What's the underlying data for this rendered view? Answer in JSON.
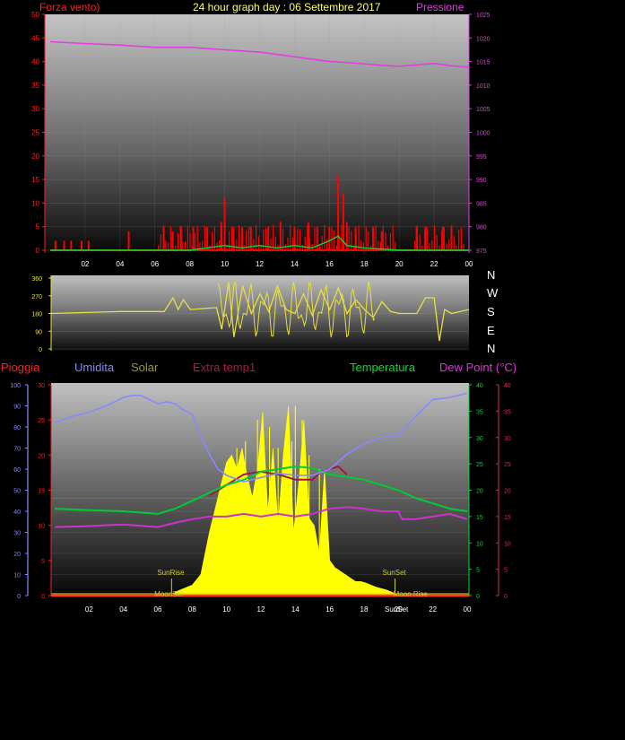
{
  "header": {
    "left_label": "Forza vento)",
    "title": "24 hour graph day : 06 Settembre 2017",
    "right_label": "Pressione"
  },
  "legend": {
    "pioggia": "Pioggia",
    "umidita": "Umidita",
    "solar": "Solar",
    "extra": "Extra temp1",
    "temp": "Temperatura",
    "dew": "Dew Point (°C)"
  },
  "directions": [
    "N",
    "W",
    "S",
    "E",
    "N"
  ],
  "annotations": {
    "sunrise": "SunRise",
    "sunset": "SunSet",
    "moonset": "MoonSet",
    "moonrise": "Moon Rise",
    "sunset2": "SunSet"
  },
  "colors": {
    "wind": "#ff0000",
    "gust": "#cc0000",
    "pressure": "#e040e0",
    "direction": "#e8e040",
    "humidity": "#8888ff",
    "solar": "#ffff00",
    "extra": "#a01840",
    "temp": "#00cc33",
    "dew": "#cc33cc",
    "rain": "#ff3333"
  },
  "chart_data": [
    {
      "type": "line",
      "name": "wind_pressure",
      "x_ticks": [
        "02",
        "04",
        "06",
        "08",
        "10",
        "12",
        "14",
        "16",
        "18",
        "20",
        "22",
        "00"
      ],
      "left_axis": {
        "ylim": [
          0,
          50
        ],
        "ticks": [
          0,
          5,
          10,
          15,
          20,
          25,
          30,
          35,
          40,
          45,
          50
        ]
      },
      "right_axis": {
        "ylim": [
          975,
          1025
        ],
        "ticks": [
          975,
          980,
          985,
          990,
          995,
          1000,
          1005,
          1010,
          1015,
          1020,
          1025
        ]
      },
      "pressure": {
        "x": [
          0,
          2,
          4,
          6,
          8,
          10,
          12,
          14,
          16,
          17,
          18,
          19,
          20,
          21,
          22,
          23,
          24
        ],
        "y": [
          1019.2,
          1018.8,
          1018.5,
          1018.0,
          1018.0,
          1017.5,
          1017.0,
          1016.0,
          1015.0,
          1014.8,
          1014.5,
          1014.2,
          1014.0,
          1014.3,
          1014.6,
          1014.1,
          1013.8
        ]
      },
      "wind_peaks": {
        "x": [
          0.3,
          0.8,
          1.2,
          1.8,
          2.2,
          4.5,
          6.5,
          7.0,
          7.5,
          8.2,
          9.0,
          9.8,
          10.0,
          10.5,
          11.0,
          11.5,
          12.5,
          13.2,
          14.0,
          14.8,
          15.3,
          16.0,
          16.5,
          16.8,
          17.0,
          17.5,
          18.5,
          19.0,
          21.0,
          21.5,
          22.5,
          23.0
        ],
        "y": [
          2,
          2,
          2,
          2,
          2,
          4,
          5,
          4,
          5,
          5,
          5,
          6,
          11,
          5,
          5,
          5,
          5,
          6,
          5,
          6,
          5,
          5,
          16,
          12,
          6,
          5,
          5,
          4,
          5,
          5,
          5,
          5
        ]
      },
      "gust_line": {
        "x": [
          0,
          8,
          10,
          11,
          12,
          13,
          14,
          15,
          16,
          16.5,
          17,
          18,
          20,
          24
        ],
        "y": [
          0,
          0,
          1,
          0.5,
          1,
          0.5,
          1,
          0.5,
          2,
          3,
          1,
          0.5,
          0,
          0
        ]
      }
    },
    {
      "type": "line",
      "name": "wind_direction",
      "ylim": [
        0,
        360
      ],
      "ticks": [
        0,
        90,
        180,
        270,
        360
      ],
      "x": [
        0,
        2,
        4,
        6.5,
        7.0,
        7.3,
        7.6,
        8.0,
        9.5,
        9.8,
        10.2,
        10.5,
        11.0,
        11.5,
        12.0,
        12.5,
        13.0,
        13.5,
        14.0,
        14.5,
        15.0,
        15.5,
        16.0,
        16.5,
        17.0,
        17.5,
        18.0,
        18.5,
        19.0,
        19.5,
        20.0,
        21.0,
        21.5,
        22.0,
        22.3,
        22.6,
        23.0,
        24.0
      ],
      "y": [
        180,
        185,
        190,
        190,
        260,
        200,
        250,
        200,
        210,
        100,
        340,
        60,
        320,
        180,
        280,
        190,
        320,
        200,
        180,
        280,
        170,
        300,
        200,
        310,
        180,
        250,
        200,
        160,
        240,
        190,
        180,
        180,
        260,
        260,
        40,
        200,
        180,
        200
      ]
    },
    {
      "type": "line",
      "name": "temperature_humidity_solar",
      "left_axis": {
        "ylim": [
          0,
          100
        ],
        "ticks": [
          0,
          10,
          20,
          30,
          40,
          50,
          60,
          70,
          80,
          90,
          100
        ]
      },
      "rain_axis": {
        "ylim": [
          0,
          30
        ],
        "ticks": [
          0,
          5,
          10,
          15,
          20,
          25,
          30
        ]
      },
      "right_axis": {
        "ylim": [
          0,
          40
        ],
        "ticks": [
          0,
          5,
          10,
          15,
          20,
          25,
          30,
          35,
          40
        ]
      },
      "right_axis2": {
        "ylim": [
          0,
          40
        ],
        "ticks": [
          0,
          5,
          10,
          15,
          20,
          25,
          30,
          35,
          40
        ]
      },
      "series": [
        {
          "name": "Umidita",
          "x": [
            0,
            1,
            2,
            3,
            4,
            4.5,
            5,
            5.5,
            6,
            6.5,
            7,
            7.5,
            8,
            8.5,
            9,
            9.5,
            10,
            11,
            12,
            13,
            14,
            15,
            16,
            17,
            18,
            19,
            20,
            21,
            22,
            23,
            24
          ],
          "y": [
            82,
            85,
            87,
            90,
            94,
            95,
            95,
            93,
            91,
            92,
            91,
            88,
            86,
            76,
            67,
            60,
            57,
            54,
            56,
            58,
            57,
            57,
            60,
            67,
            72,
            75,
            76,
            85,
            93,
            94,
            96
          ]
        },
        {
          "name": "Temperatura",
          "x": [
            0,
            2,
            4,
            6,
            7,
            8,
            9,
            10,
            11,
            12,
            13,
            14,
            15,
            16,
            17,
            18,
            19,
            20,
            21,
            22,
            23,
            24
          ],
          "y": [
            16.5,
            16.2,
            16.0,
            15.5,
            16.5,
            18.0,
            19.5,
            21.0,
            22.0,
            23.5,
            24.0,
            24.5,
            24.2,
            23.0,
            22.5,
            22.0,
            21.0,
            20.0,
            18.5,
            17.5,
            16.5,
            16.0
          ]
        },
        {
          "name": "Dew Point (°C)",
          "x": [
            0,
            2,
            4,
            6,
            7,
            8,
            9,
            10,
            11,
            12,
            13,
            14,
            15,
            16,
            17,
            18,
            19,
            20,
            20.2,
            21,
            22,
            23,
            24
          ],
          "y": [
            13.0,
            13.2,
            13.5,
            13.0,
            13.8,
            14.5,
            15.0,
            15.0,
            15.5,
            15.0,
            15.5,
            15.0,
            15.5,
            16.5,
            16.8,
            16.5,
            16.0,
            16.0,
            14.5,
            14.5,
            15.0,
            15.5,
            14.5
          ]
        },
        {
          "name": "Extra temp1",
          "x": [
            0,
            8,
            9,
            10,
            10.5,
            11,
            12,
            13,
            14,
            15,
            15.5,
            16,
            16.5,
            17,
            18,
            24
          ],
          "y": [
            0,
            0,
            19,
            21,
            22,
            23,
            23.5,
            23,
            22,
            22,
            23.5,
            24,
            24.5,
            23,
            0,
            0
          ]
        },
        {
          "name": "Solar",
          "x": [
            0,
            6.9,
            7.0,
            7.5,
            8.0,
            8.5,
            9.0,
            9.3,
            9.6,
            10.0,
            10.3,
            10.6,
            10.9,
            11.2,
            11.5,
            11.8,
            12.1,
            12.4,
            12.7,
            13.0,
            13.3,
            13.6,
            13.9,
            14.2,
            14.5,
            14.8,
            15.1,
            15.4,
            15.7,
            16.0,
            16.3,
            16.6,
            16.9,
            17.2,
            17.5,
            17.8,
            18.1,
            18.4,
            18.7,
            19.0,
            19.3,
            19.6,
            20.0,
            24
          ],
          "y": [
            0,
            0,
            0.5,
            1.0,
            1.5,
            3.0,
            9.0,
            12.0,
            15.0,
            19.0,
            20.0,
            18.0,
            21.0,
            17.0,
            14.0,
            18.0,
            26.0,
            12.0,
            21.0,
            10.0,
            20.0,
            27.0,
            9.0,
            16.0,
            25.0,
            11.0,
            10.0,
            6.0,
            18.0,
            5.0,
            4.0,
            3.5,
            3.0,
            2.5,
            2.0,
            2.0,
            1.8,
            1.5,
            1.2,
            1.0,
            0.8,
            0.5,
            0,
            0
          ]
        },
        {
          "name": "Pioggia",
          "x": [
            0,
            24
          ],
          "y": [
            0,
            0
          ]
        }
      ]
    }
  ]
}
